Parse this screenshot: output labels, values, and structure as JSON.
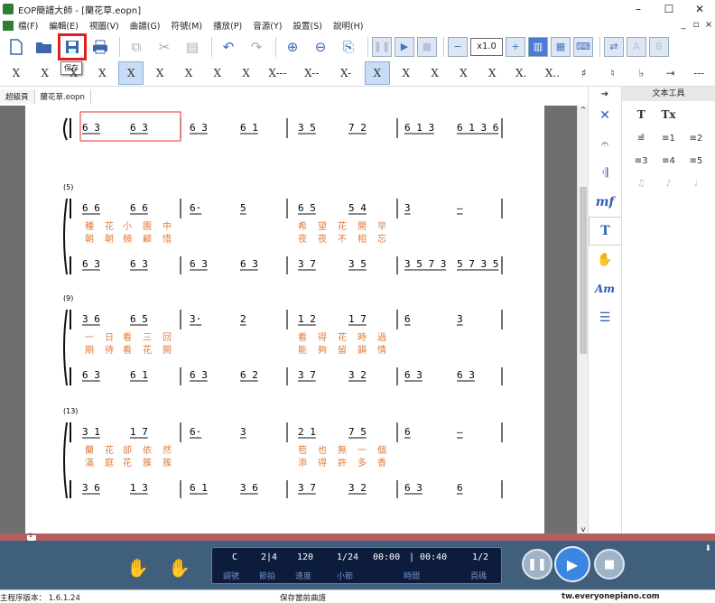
{
  "app": {
    "title": "EOP簡譜大師 - [蘭花草.eopn]"
  },
  "window_controls": {
    "minimize": "–",
    "maximize": "☐",
    "close": "✕"
  },
  "mdi_controls": {
    "minimize": "_",
    "restore": "▫",
    "close": "×"
  },
  "menu": [
    "檔(F)",
    "編輯(E)",
    "視圖(V)",
    "曲譜(G)",
    "符號(M)",
    "播放(P)",
    "音源(Y)",
    "設置(S)",
    "說明(H)"
  ],
  "toolbar": {
    "tooltip": "保存",
    "zoom": "x1.0",
    "letters": [
      "A",
      "B"
    ]
  },
  "note_toolbar": [
    "X",
    "X",
    "X",
    "X",
    "X",
    "X",
    "X",
    "X",
    "X---",
    "X--",
    "X-",
    "X",
    "X",
    "X",
    "X",
    "X",
    "X.",
    "X..",
    "♯",
    "♮",
    "♭",
    "⇥",
    "---"
  ],
  "tabs": [
    "超級頁",
    "蘭花草.eopn"
  ],
  "score": {
    "systems": [
      {
        "number": "",
        "upper": [
          "6 3",
          "6 3",
          "6 3",
          "6 1",
          "3 5",
          "7 2",
          "6 1 3",
          "6 1 3 6"
        ],
        "lyrics1": [],
        "lyrics2": [],
        "lower": []
      },
      {
        "number": "(5)",
        "upper": [
          "6 6",
          "6 6",
          "6·",
          "5",
          "6 5",
          "5 4",
          "3",
          "–"
        ],
        "lyrics1": [
          "種",
          "花",
          "小",
          "園",
          "中",
          "",
          "希",
          "望",
          "花",
          "開",
          "早"
        ],
        "lyrics2": [
          "朝",
          "朝",
          "頻",
          "顧",
          "惜",
          "",
          "夜",
          "夜",
          "不",
          "相",
          "忘"
        ],
        "lower": [
          "6 3",
          "6 3",
          "6 3",
          "6 3",
          "3 7",
          "3 5",
          "3 5 7 3",
          "5 7 3 5"
        ]
      },
      {
        "number": "(9)",
        "upper": [
          "3 6",
          "6 5",
          "3·",
          "2",
          "1 2",
          "1 7",
          "6",
          "3"
        ],
        "lyrics1": [
          "一",
          "日",
          "看",
          "三",
          "回",
          "",
          "看",
          "得",
          "花",
          "時",
          "過"
        ],
        "lyrics2": [
          "期",
          "待",
          "看",
          "花",
          "開",
          "",
          "能",
          "夠",
          "留",
          "韻",
          "情"
        ],
        "lower": [
          "6 3",
          "6 1",
          "6 3",
          "6 2",
          "3 7",
          "3 2",
          "6 3",
          "6 3"
        ]
      },
      {
        "number": "(13)",
        "upper": [
          "3 1",
          "1 7",
          "6·",
          "3",
          "2 1",
          "7 5",
          "6",
          "–"
        ],
        "lyrics1": [
          "蘭",
          "花",
          "卻",
          "依",
          "然",
          "",
          "苞",
          "也",
          "無",
          "一",
          "個"
        ],
        "lyrics2": [
          "滿",
          "庭",
          "花",
          "簇",
          "簇",
          "",
          "添",
          "得",
          "許",
          "多",
          "香"
        ],
        "lower": [
          "3 6",
          "1 3",
          "6 1",
          "3 6",
          "3 7",
          "3 2",
          "6 3",
          "6"
        ]
      }
    ]
  },
  "right_panel": {
    "title": "文本工具",
    "tools": [
      "T",
      "Tx",
      "",
      "≡̂",
      "≡1",
      "≡2",
      "≡3",
      "≡4",
      "≡5",
      "♫",
      "♪",
      "♩"
    ]
  },
  "playback": {
    "key": "C",
    "time_sig": "2|4",
    "tempo": "120",
    "measure": "1/24",
    "time_elapsed": "00:00",
    "time_total": "00:40",
    "page": "1/2",
    "labels": [
      "調號",
      "節拍",
      "速度",
      "小節",
      "時間",
      "頁碼"
    ],
    "marker": "1"
  },
  "status": {
    "version": "主程序版本： 1.6.1.24",
    "message": "保存當前曲譜",
    "url": "tw.everyonepiano.com"
  }
}
